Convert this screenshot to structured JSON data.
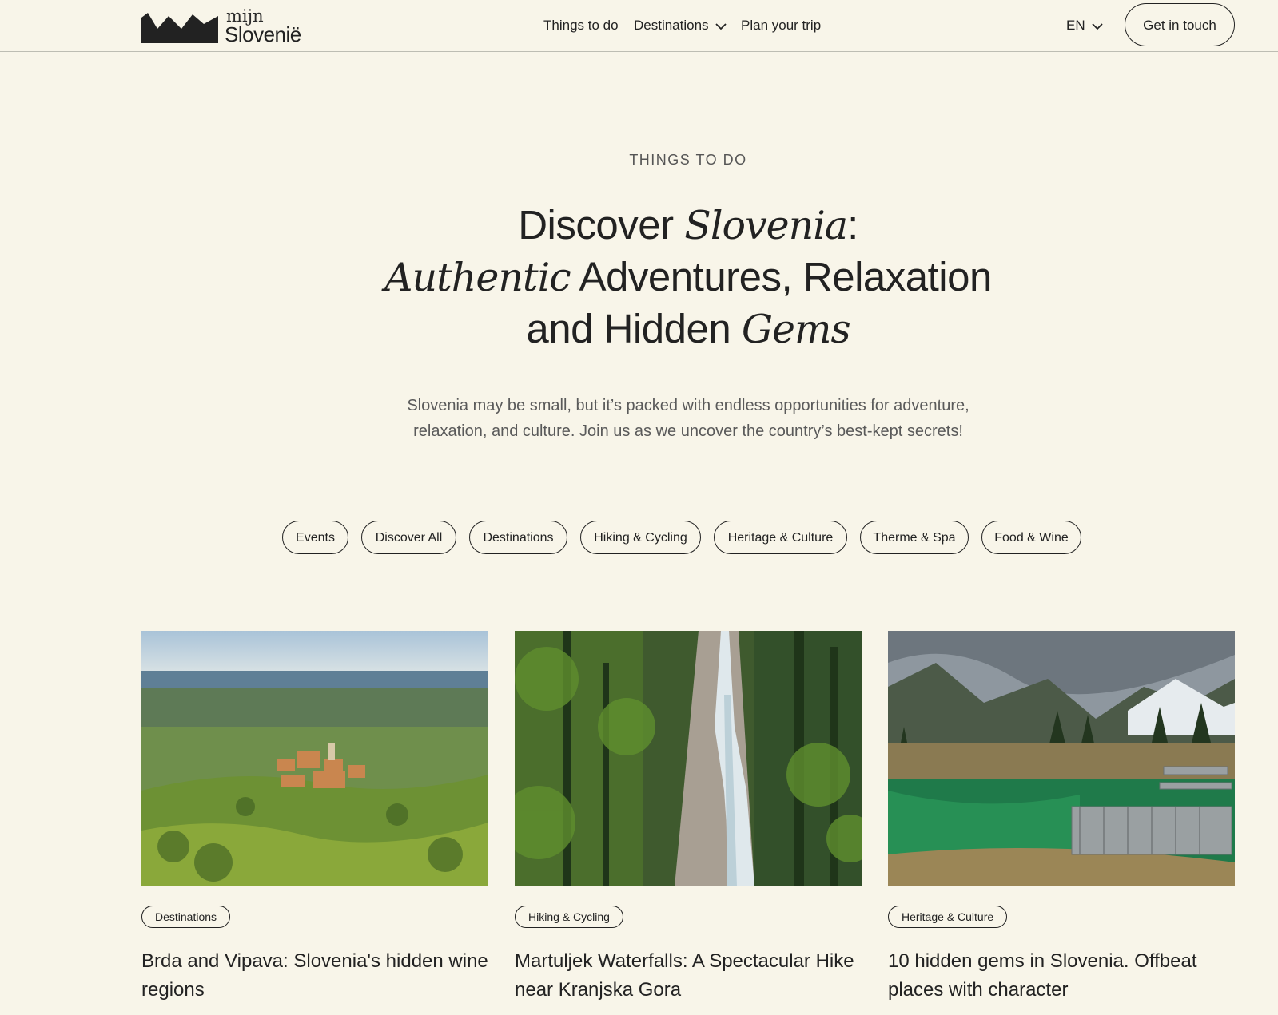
{
  "header": {
    "logo_small": "mijn",
    "logo_brand": "Slovenië",
    "nav": [
      {
        "label": "Things to do",
        "has_dropdown": false
      },
      {
        "label": "Destinations",
        "has_dropdown": true
      },
      {
        "label": "Plan your trip",
        "has_dropdown": false
      }
    ],
    "language": "EN",
    "cta_label": "Get in touch"
  },
  "hero": {
    "eyebrow": "THINGS TO DO",
    "headline": {
      "line1_a": "Discover ",
      "line1_b": "Slovenia",
      "line1_c": ":",
      "line2_a": "Authentic",
      "line2_b": " Adventures, Relaxation",
      "line3_a": "and Hidden ",
      "line3_b": "Gems"
    },
    "lead": "Slovenia may be small, but it’s packed with endless opportunities for adventure, relaxation, and culture. Join us as we uncover the country’s best-kept secrets!"
  },
  "filters": [
    "Events",
    "Discover All",
    "Destinations",
    "Hiking & Cycling",
    "Heritage & Culture",
    "Therme & Spa",
    "Food & Wine"
  ],
  "cards": [
    {
      "tag": "Destinations",
      "title": "Brda and Vipava: Slovenia's hidden wine regions"
    },
    {
      "tag": "Hiking & Cycling",
      "title": "Martuljek Waterfalls: A Spectacular Hike near Kranjska Gora"
    },
    {
      "tag": "Heritage & Culture",
      "title": "10 hidden gems in Slovenia. Offbeat places with character"
    }
  ],
  "colors": {
    "background": "#f8f5e9",
    "text": "#222222",
    "muted": "#5a5a5a"
  },
  "icons": [
    "mountain-logo-icon",
    "chevron-down-icon"
  ]
}
